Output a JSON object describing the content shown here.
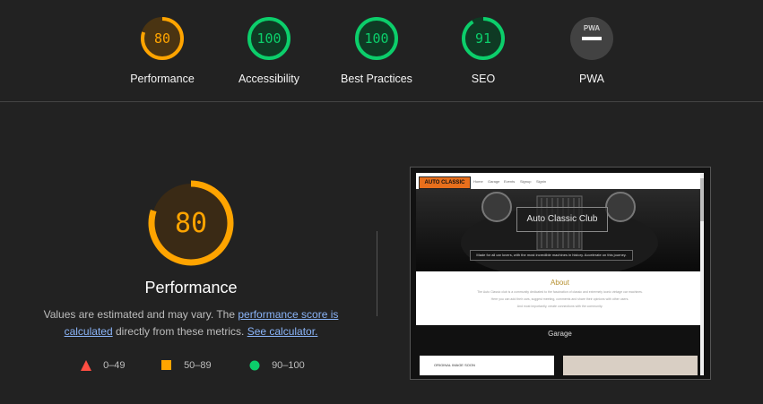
{
  "gauges": [
    {
      "score": 80,
      "label": "Performance",
      "color": "#ffa400",
      "bg": "#4a3412",
      "fraction": 0.8
    },
    {
      "score": 100,
      "label": "Accessibility",
      "color": "#0cce6b",
      "bg": "#0f3a24",
      "fraction": 1.0
    },
    {
      "score": 100,
      "label": "Best Practices",
      "color": "#0cce6b",
      "bg": "#0f3a24",
      "fraction": 1.0
    },
    {
      "score": 91,
      "label": "SEO",
      "color": "#0cce6b",
      "bg": "#0f3a24",
      "fraction": 0.91
    },
    {
      "score": "",
      "badge": "PWA",
      "label": "PWA",
      "color": "#9e9e9e",
      "bg": "#424242"
    }
  ],
  "main": {
    "score": 80,
    "title": "Performance",
    "color": "#ffa400",
    "bg": "#3a2a15",
    "desc_prefix": "Values are estimated and may vary. The ",
    "link1": "performance score is calculated",
    "desc_mid": " directly from these metrics. ",
    "link2": "See calculator."
  },
  "legend": [
    {
      "range": "0–49",
      "shape": "triangle",
      "color": "#ff4e42"
    },
    {
      "range": "50–89",
      "shape": "square",
      "color": "#ffa400"
    },
    {
      "range": "90–100",
      "shape": "circle",
      "color": "#0cce6b"
    }
  ],
  "screenshot": {
    "logo": "AUTO CLASSIC",
    "nav": [
      "Home",
      "Garage",
      "Events",
      "Signup",
      "Signin"
    ],
    "hero_title": "Auto Classic Club",
    "hero_sub": "Made for all car lovers, with the most incredible machines in history. Accelerate on this journey.",
    "about_title": "About",
    "about_lines": [
      "The Auto Classic club is a community dedicated to the fascination of classic and extremely iconic vintage car machines.",
      "Here you can add their cars, suggest meeting, comments and share their opinions with other users.",
      "And most importantly, create connections with the community."
    ],
    "garage_title": "Garage",
    "card_text": "ORIGINAL IMAGE SOON"
  }
}
